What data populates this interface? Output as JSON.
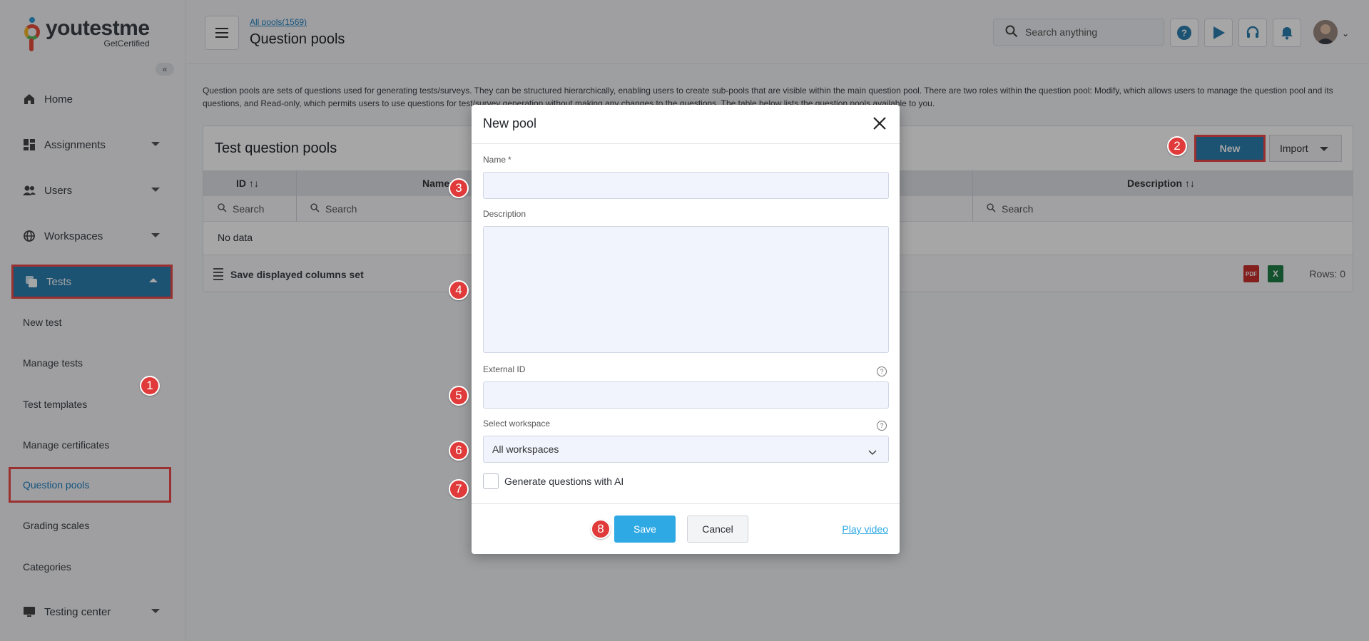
{
  "brand": {
    "name": "youtestme",
    "sub": "GetCertified"
  },
  "sidebar": {
    "items": [
      {
        "label": "Home"
      },
      {
        "label": "Assignments"
      },
      {
        "label": "Users"
      },
      {
        "label": "Workspaces"
      },
      {
        "label": "Tests"
      },
      {
        "label": "Testing center"
      }
    ],
    "sub_items": [
      {
        "label": "New test"
      },
      {
        "label": "Manage tests"
      },
      {
        "label": "Test templates"
      },
      {
        "label": "Manage certificates"
      },
      {
        "label": "Question pools"
      },
      {
        "label": "Grading scales"
      },
      {
        "label": "Categories"
      }
    ]
  },
  "header": {
    "breadcrumb": "All pools(1569)",
    "title": "Question pools",
    "search_placeholder": "Search anything"
  },
  "intro": "Question pools are sets of questions used for generating tests/surveys. They can be structured hierarchically, enabling users to create sub-pools that are visible within the main question pool. There are two roles within the question pool: Modify, which allows users to manage the question pool and its questions, and Read-only, which permits users to use questions for test/survey generation without making any changes to the questions. The table below lists the question pools available to you.",
  "table": {
    "title": "Test question pools",
    "new_label": "New",
    "import_label": "Import",
    "columns": [
      {
        "label": "ID",
        "sort": "↑↓"
      },
      {
        "label": "Name",
        "sort": ""
      },
      {
        "label": "Description",
        "sort": "↑↓"
      }
    ],
    "search_label": "Search",
    "empty_text": "No data",
    "save_columns_label": "Save displayed columns set",
    "rows_label": "Rows: 0",
    "pdf_label": "PDF",
    "xls_label": "X"
  },
  "modal": {
    "title": "New pool",
    "name_label": "Name",
    "name_required": "*",
    "description_label": "Description",
    "external_id_label": "External ID",
    "workspace_label": "Select workspace",
    "workspace_value": "All workspaces",
    "ai_label": "Generate questions with AI",
    "save_label": "Save",
    "cancel_label": "Cancel",
    "play_video_label": "Play video"
  },
  "badges": [
    "1",
    "2",
    "3",
    "4",
    "5",
    "6",
    "7",
    "8"
  ],
  "colors": {
    "accent": "#2c7fb0",
    "highlight": "#ef4b4b",
    "primary_button": "#2ea9e4"
  }
}
